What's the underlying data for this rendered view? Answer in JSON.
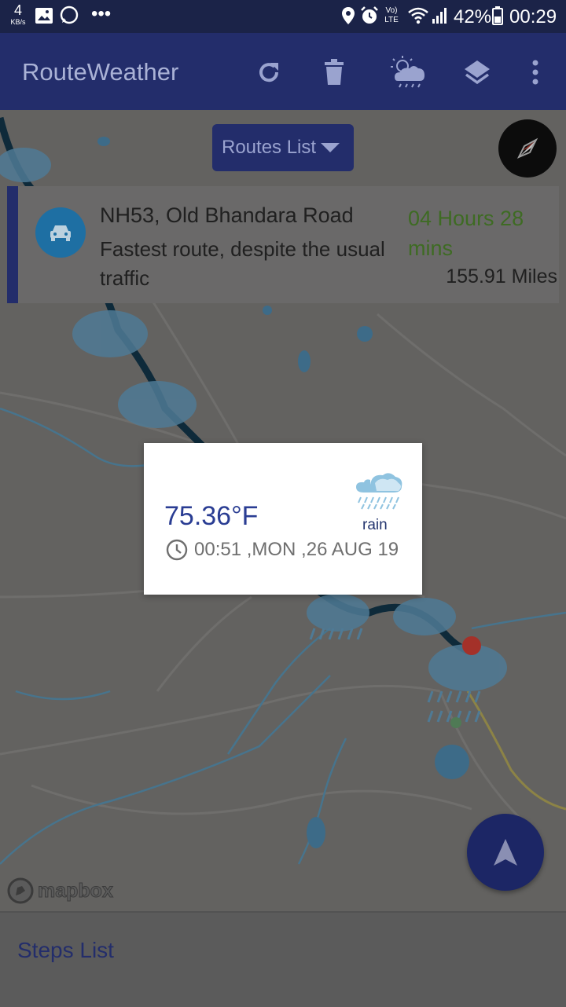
{
  "status_bar": {
    "speed_value": "4",
    "speed_unit": "KB/s",
    "overflow": "•••",
    "volte_label": "Vo) LTE",
    "battery": "42%",
    "time": "00:29"
  },
  "app_bar": {
    "title": "RouteWeather",
    "icons": [
      "refresh-icon",
      "delete-icon",
      "weather-icon",
      "layers-icon",
      "more-vert-icon"
    ]
  },
  "routes_dropdown": {
    "label": "Routes List"
  },
  "route_card": {
    "name": "NH53, Old Bhandara Road",
    "description": "Fastest route, despite the usual traffic",
    "duration": "04 Hours 28 mins",
    "distance": "155.91 Miles"
  },
  "weather_popup": {
    "temperature": "75.36°F",
    "condition": "rain",
    "datetime": "00:51 ,MON ,26 AUG 19"
  },
  "map": {
    "attribution": "mapbox"
  },
  "steps_panel": {
    "label": "Steps List"
  },
  "colors": {
    "primary": "#232d6b",
    "status_bar": "#1b2348",
    "duration_text": "#3e6b23",
    "temperature_text": "#2a3d93"
  }
}
